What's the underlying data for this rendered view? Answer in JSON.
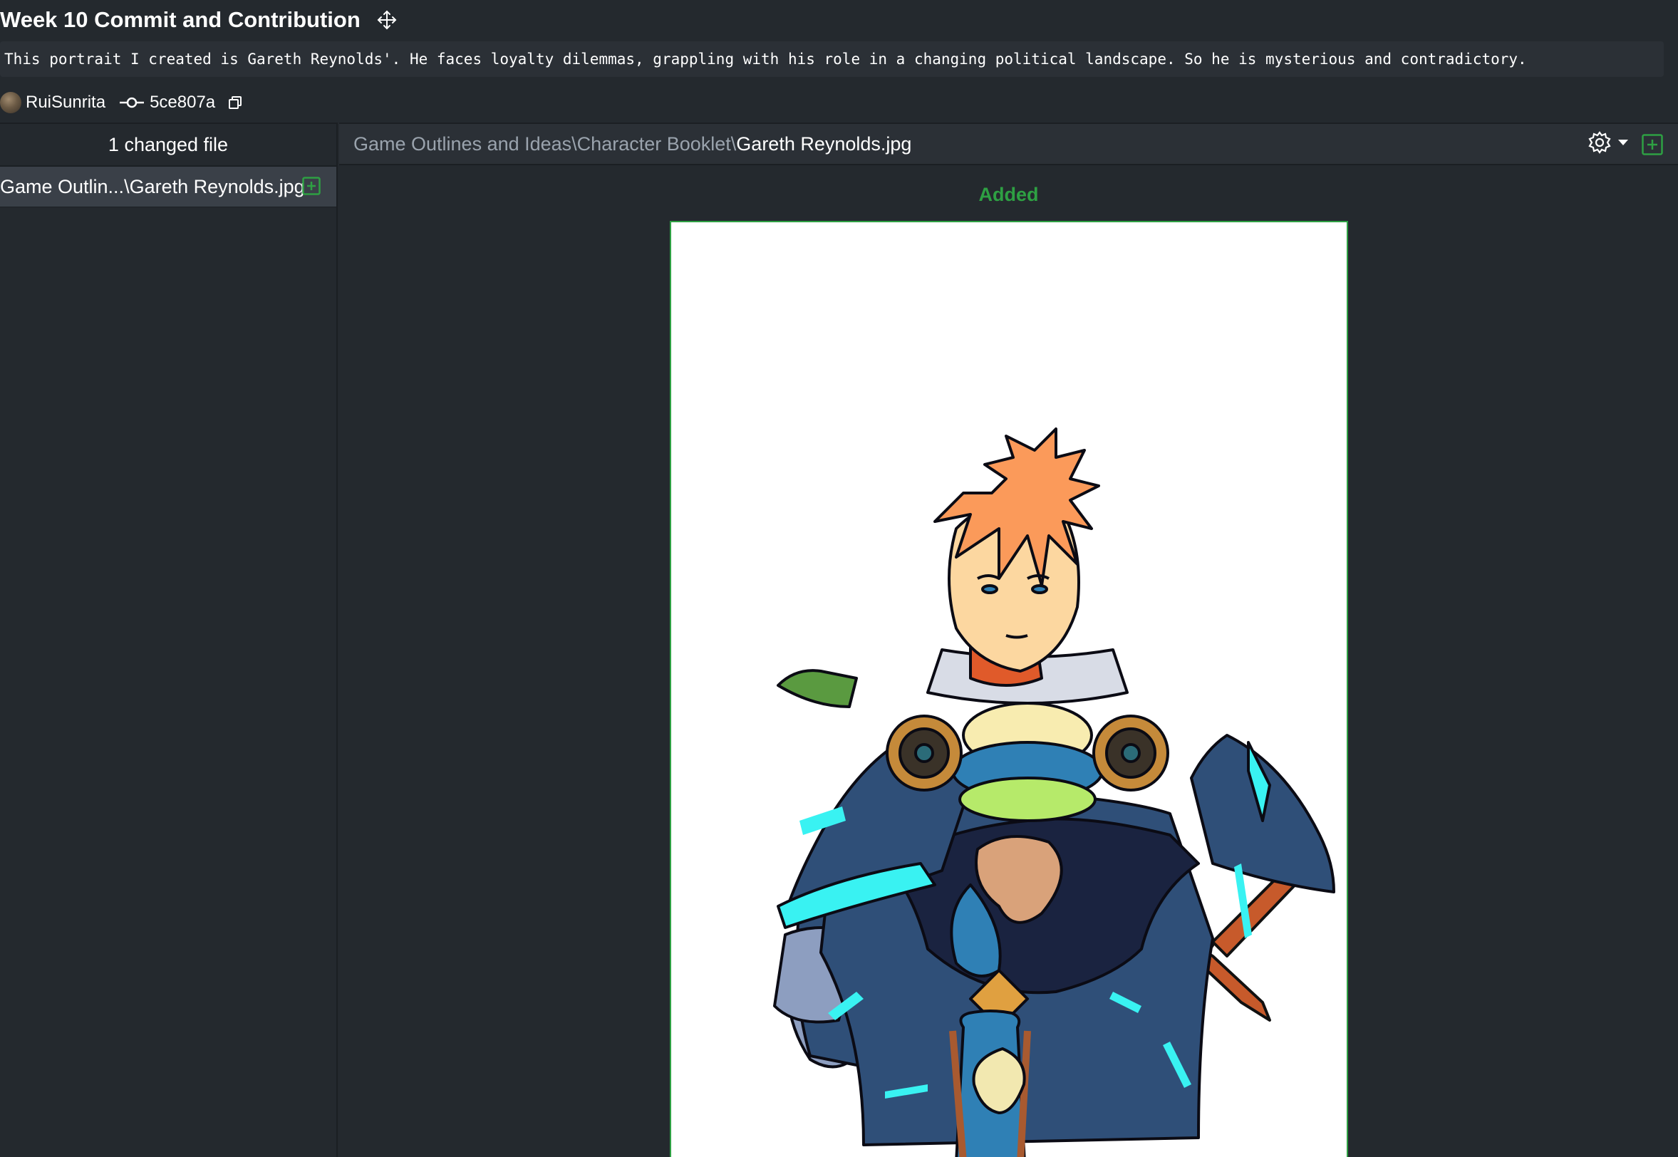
{
  "header": {
    "title": "Week 10 Commit and Contribution",
    "description": "This portrait I created is Gareth Reynolds'. He faces loyalty dilemmas, grappling with his role in a changing political landscape. So he is mysterious and contradictory.",
    "author": "RuiSunrita",
    "sha": "5ce807a"
  },
  "sidebar": {
    "changed_label": "1 changed file",
    "files": [
      {
        "name": "Game Outlin...\\Gareth Reynolds.jpg",
        "status": "added"
      }
    ]
  },
  "diff": {
    "path_prefix": "Game Outlines and Ideas\\Character Booklet\\",
    "file_name": "Gareth Reynolds.jpg",
    "status_label": "Added"
  },
  "colors": {
    "added": "#2ea043",
    "background": "#24292e"
  },
  "icons": {
    "drag": "move-arrows-icon",
    "commit": "commit-icon",
    "copy": "copy-icon",
    "settings": "gear-icon",
    "add": "plus-square-icon"
  }
}
